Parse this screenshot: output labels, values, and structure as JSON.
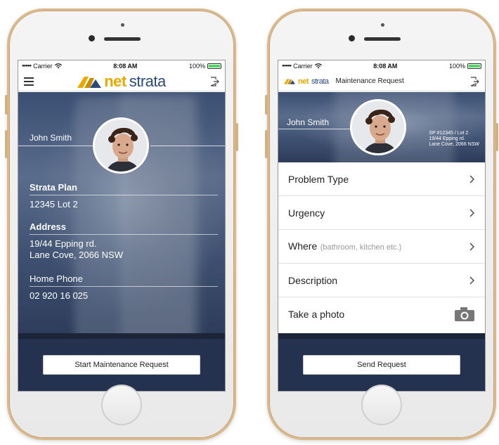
{
  "status": {
    "carrier": "Carrier",
    "signal_dots": "●●●●●",
    "time": "8:08 AM",
    "battery": "100%",
    "battery_level": 1.0
  },
  "brand": {
    "net": "net",
    "strata": "strata",
    "accent": "#e8a800",
    "primary": "#2b4a7a"
  },
  "profile_screen": {
    "user_name": "John Smith",
    "fields": [
      {
        "label": "Strata Plan",
        "value": "12345 Lot 2"
      },
      {
        "label": "Address",
        "value_line1": "19/44 Epping rd.",
        "value_line2": "Lane Cove, 2066 NSW"
      },
      {
        "label": "Home Phone",
        "value": "02 920 16 025"
      }
    ],
    "cta_label": "Start Maintenance Request"
  },
  "request_screen": {
    "nav_title": "Maintenance Request",
    "user_name": "John Smith",
    "sp_line1": "SP #12345 / Lot 2",
    "sp_line2": "19/44 Epping rd.",
    "sp_line3": "Lane Cove, 2066 NSW",
    "menu": [
      {
        "label": "Problem Type",
        "hint": "",
        "icon": "chevron-right-icon"
      },
      {
        "label": "Urgency",
        "hint": "",
        "icon": "chevron-right-icon"
      },
      {
        "label": "Where",
        "hint": "(bathroom, kitchen etc.)",
        "icon": "chevron-right-icon"
      },
      {
        "label": "Description",
        "hint": "",
        "icon": "chevron-right-icon"
      },
      {
        "label": "Take a photo",
        "hint": "",
        "icon": "camera-icon"
      }
    ],
    "cta_label": "Send Request"
  },
  "colors": {
    "footer": "#25324f",
    "hero": "#3a4f72",
    "battery_fill": "#4cd964"
  }
}
